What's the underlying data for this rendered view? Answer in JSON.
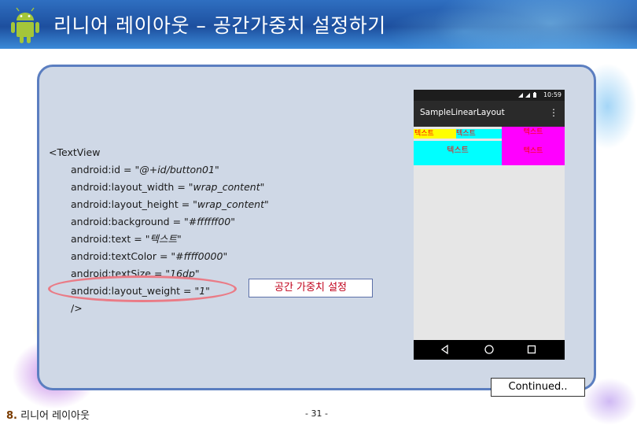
{
  "slide": {
    "title": "리니어 레이아웃 – 공간가중치 설정하기",
    "icon": "android-robot-icon"
  },
  "code": {
    "open_tag": "<TextView",
    "lines": [
      {
        "attr": "android:id",
        "eq": " = ",
        "value": "\"@+id/button01\""
      },
      {
        "attr": "android:layout_width",
        "eq": " = ",
        "value": "\"wrap_content\""
      },
      {
        "attr": "android:layout_height",
        "eq": " = ",
        "value": "\"wrap_content\""
      },
      {
        "attr": "android:background",
        "eq": " = ",
        "value": "\"#ffffff00\""
      },
      {
        "attr": "android:text",
        "eq": " = ",
        "value": "\"텍스트\""
      },
      {
        "attr": "android:textColor",
        "eq": " = ",
        "value": "\"#ffff0000\""
      },
      {
        "attr": "android:textSize",
        "eq": " = ",
        "value": "\"16dp\""
      },
      {
        "attr": "android:layout_weight",
        "eq": " = ",
        "value": "\"1\""
      }
    ],
    "close_tag": "/>"
  },
  "callout": "공간 가중치 설정",
  "phone": {
    "time": "10:59",
    "app_title": "SampleLinearLayout",
    "menu_icon": "overflow-menu-icon",
    "row1": [
      "텍스트",
      "텍스트",
      "텍스트"
    ],
    "row2": [
      "텍스트",
      "텍스트"
    ],
    "colors": {
      "yellow": "#ffff00",
      "cyan": "#00ffff",
      "magenta": "#ff00ff",
      "red_text": "#ff0000"
    },
    "nav": [
      "back-icon",
      "home-icon",
      "recents-icon"
    ]
  },
  "continued": "Continued..",
  "footer": {
    "section_number": "8.",
    "section_title": "리니어 레이아웃"
  },
  "page_number": "- 31 -"
}
